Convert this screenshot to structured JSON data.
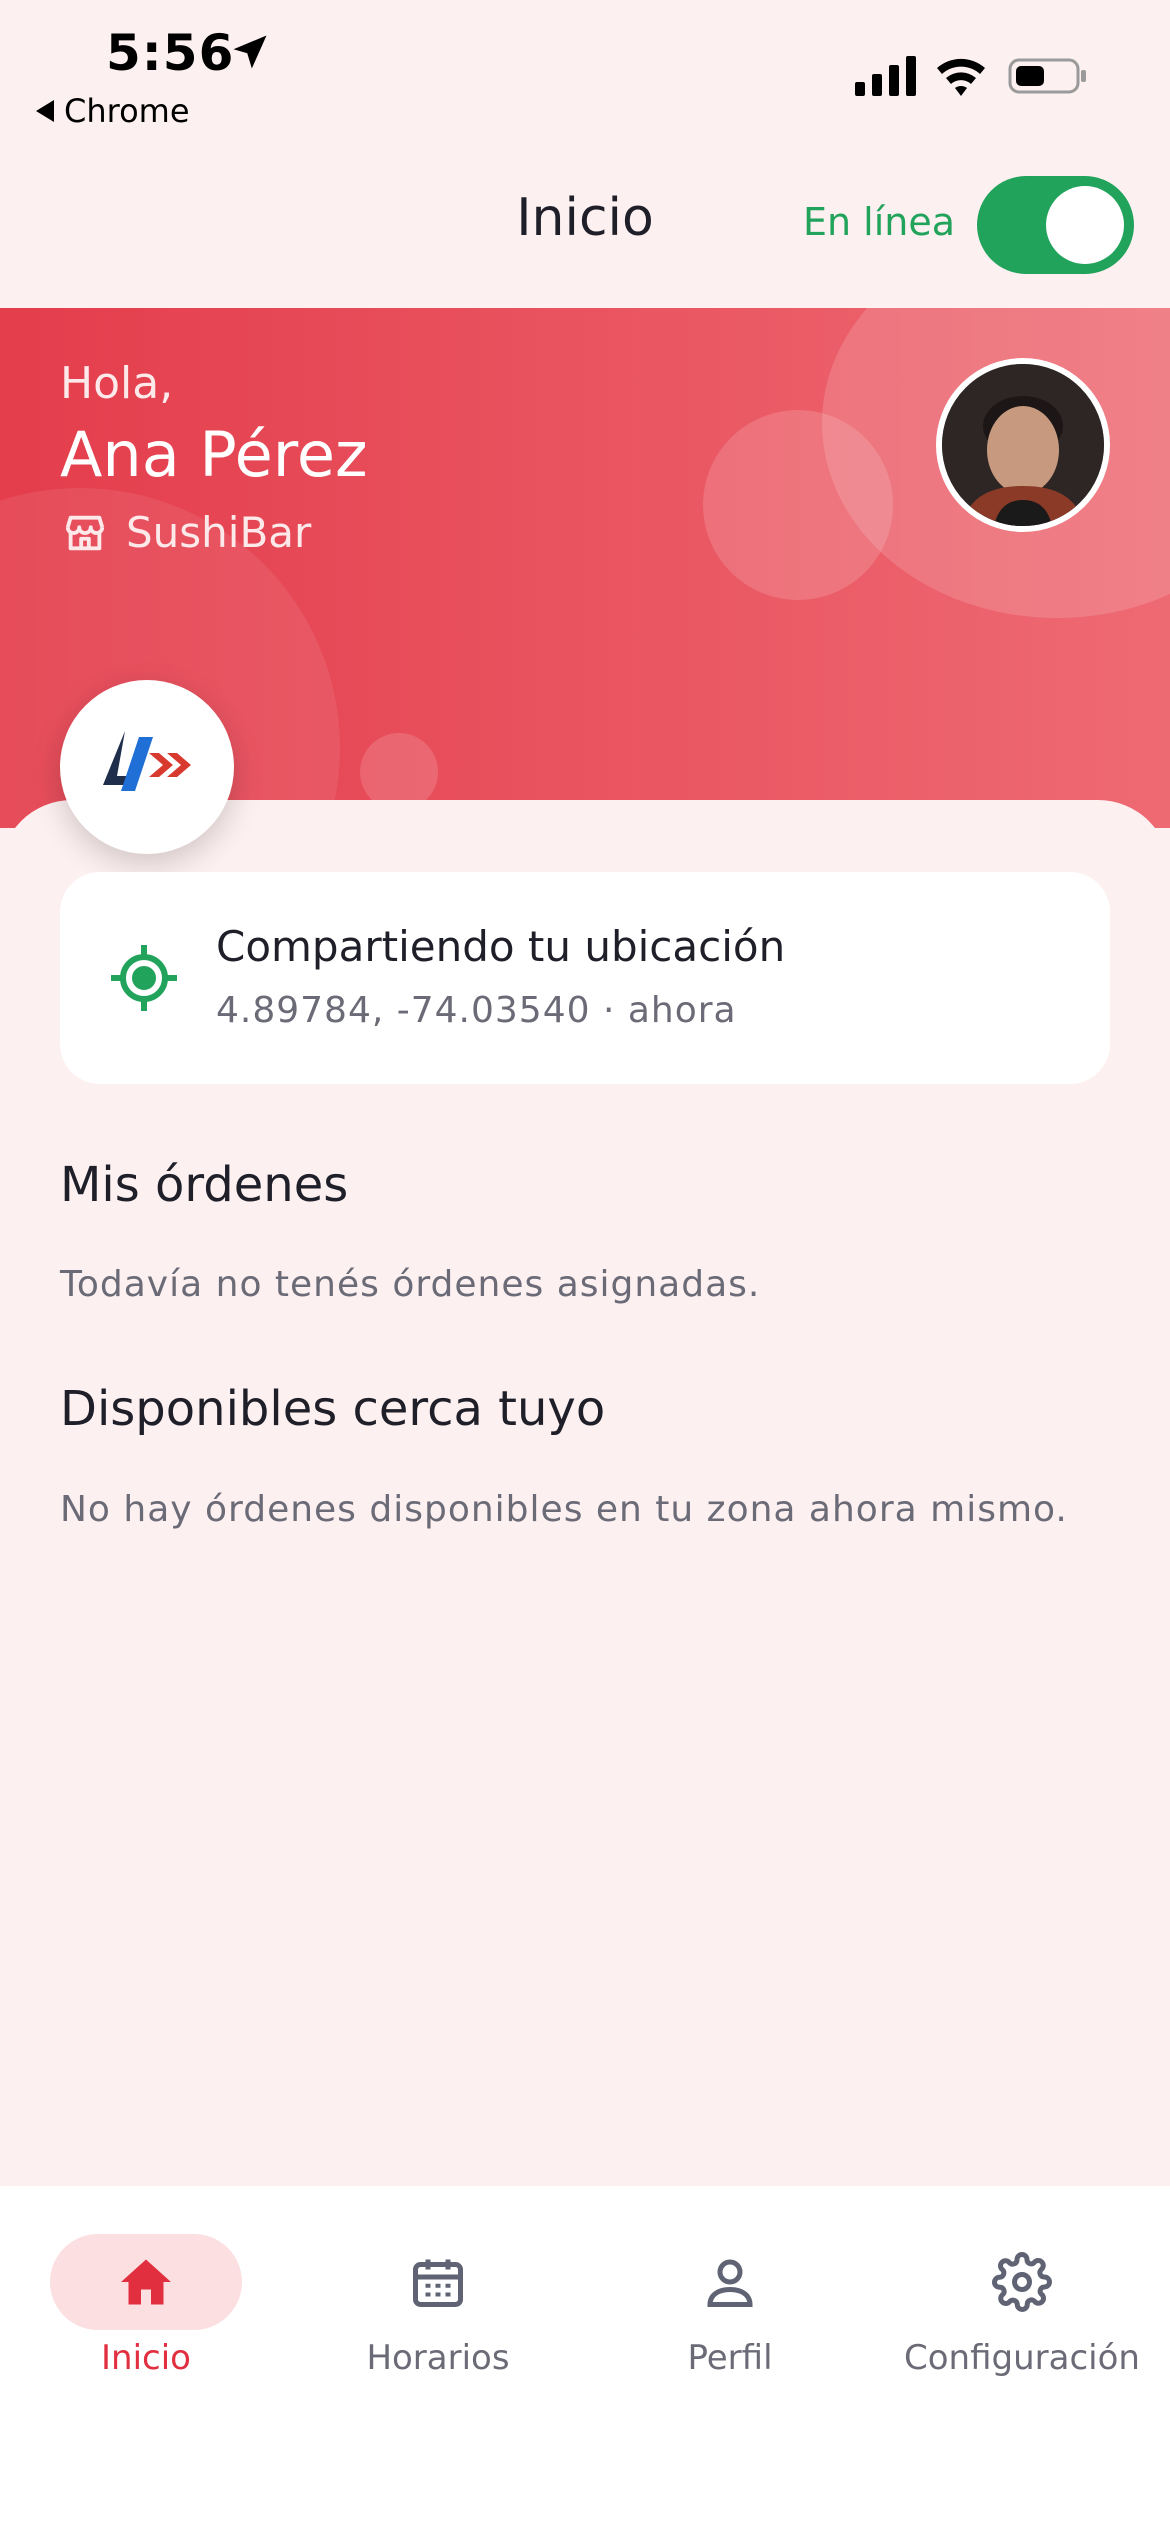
{
  "status_bar": {
    "time": "5:56",
    "back_label": "Chrome"
  },
  "header": {
    "title": "Inicio",
    "online_label": "En línea",
    "online": true
  },
  "hero": {
    "greeting": "Hola,",
    "name": "Ana Pérez",
    "store": "SushiBar"
  },
  "location_card": {
    "title": "Compartiendo tu ubicación",
    "coords": "4.89784, -74.03540 · ahora"
  },
  "orders": {
    "title": "Mis órdenes",
    "empty": "Todavía no tenés órdenes asignadas."
  },
  "nearby": {
    "title": "Disponibles cerca tuyo",
    "empty": "No hay órdenes disponibles en tu zona ahora mismo."
  },
  "tabs": [
    {
      "label": "Inicio",
      "icon": "home-icon",
      "active": true
    },
    {
      "label": "Horarios",
      "icon": "calendar-icon",
      "active": false
    },
    {
      "label": "Perfil",
      "icon": "user-icon",
      "active": false
    },
    {
      "label": "Configuración",
      "icon": "gear-icon",
      "active": false
    }
  ],
  "colors": {
    "brand": "#e12f3f",
    "online": "#21a35b",
    "background": "#fdf0f0"
  }
}
